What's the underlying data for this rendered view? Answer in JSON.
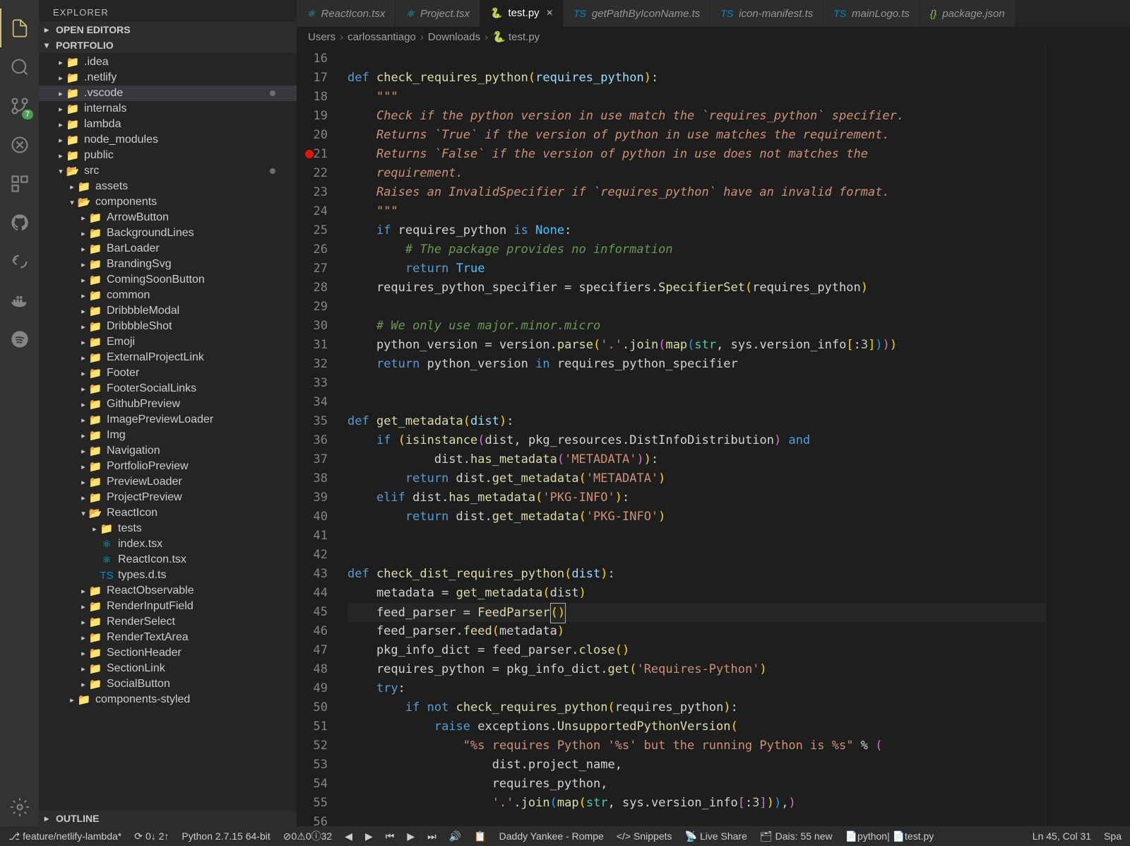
{
  "sidebar": {
    "title": "EXPLORER",
    "openEditors": "OPEN EDITORS",
    "projectName": "PORTFOLIO",
    "outline": "OUTLINE",
    "scm_badge": "7",
    "tree": [
      {
        "indent": 1,
        "chev": "▸",
        "iconClass": "folder-grey",
        "icon": "📁",
        "label": ".idea"
      },
      {
        "indent": 1,
        "chev": "▸",
        "iconClass": "folder-grey",
        "icon": "📁",
        "label": ".netlify"
      },
      {
        "indent": 1,
        "chev": "▸",
        "iconClass": "folder-blue",
        "icon": "📁",
        "label": ".vscode",
        "mod": true,
        "selected": true
      },
      {
        "indent": 1,
        "chev": "▸",
        "iconClass": "folder-grey",
        "icon": "📁",
        "label": "internals"
      },
      {
        "indent": 1,
        "chev": "▸",
        "iconClass": "folder-i",
        "icon": "📁",
        "label": "lambda"
      },
      {
        "indent": 1,
        "chev": "▸",
        "iconClass": "folder-green",
        "icon": "📁",
        "label": "node_modules"
      },
      {
        "indent": 1,
        "chev": "▸",
        "iconClass": "folder-blue",
        "icon": "📁",
        "label": "public"
      },
      {
        "indent": 1,
        "chev": "▾",
        "iconClass": "folder-green",
        "icon": "📂",
        "label": "src",
        "mod": true
      },
      {
        "indent": 2,
        "chev": "▸",
        "iconClass": "folder-yellow",
        "icon": "📁",
        "label": "assets"
      },
      {
        "indent": 2,
        "chev": "▾",
        "iconClass": "folder-teal",
        "icon": "📂",
        "label": "components"
      },
      {
        "indent": 3,
        "chev": "▸",
        "iconClass": "folder-grey",
        "icon": "📁",
        "label": "ArrowButton"
      },
      {
        "indent": 3,
        "chev": "▸",
        "iconClass": "folder-grey",
        "icon": "📁",
        "label": "BackgroundLines"
      },
      {
        "indent": 3,
        "chev": "▸",
        "iconClass": "folder-grey",
        "icon": "📁",
        "label": "BarLoader"
      },
      {
        "indent": 3,
        "chev": "▸",
        "iconClass": "folder-grey",
        "icon": "📁",
        "label": "BrandingSvg"
      },
      {
        "indent": 3,
        "chev": "▸",
        "iconClass": "folder-grey",
        "icon": "📁",
        "label": "ComingSoonButton"
      },
      {
        "indent": 3,
        "chev": "▸",
        "iconClass": "folder-grey",
        "icon": "📁",
        "label": "common"
      },
      {
        "indent": 3,
        "chev": "▸",
        "iconClass": "folder-grey",
        "icon": "📁",
        "label": "DribbbleModal"
      },
      {
        "indent": 3,
        "chev": "▸",
        "iconClass": "folder-grey",
        "icon": "📁",
        "label": "DribbbleShot"
      },
      {
        "indent": 3,
        "chev": "▸",
        "iconClass": "folder-grey",
        "icon": "📁",
        "label": "Emoji"
      },
      {
        "indent": 3,
        "chev": "▸",
        "iconClass": "folder-grey",
        "icon": "📁",
        "label": "ExternalProjectLink"
      },
      {
        "indent": 3,
        "chev": "▸",
        "iconClass": "folder-grey",
        "icon": "📁",
        "label": "Footer"
      },
      {
        "indent": 3,
        "chev": "▸",
        "iconClass": "folder-grey",
        "icon": "📁",
        "label": "FooterSocialLinks"
      },
      {
        "indent": 3,
        "chev": "▸",
        "iconClass": "folder-grey",
        "icon": "📁",
        "label": "GithubPreview"
      },
      {
        "indent": 3,
        "chev": "▸",
        "iconClass": "folder-grey",
        "icon": "📁",
        "label": "ImagePreviewLoader"
      },
      {
        "indent": 3,
        "chev": "▸",
        "iconClass": "folder-teal",
        "icon": "📁",
        "label": "Img"
      },
      {
        "indent": 3,
        "chev": "▸",
        "iconClass": "folder-grey",
        "icon": "📁",
        "label": "Navigation"
      },
      {
        "indent": 3,
        "chev": "▸",
        "iconClass": "folder-grey",
        "icon": "📁",
        "label": "PortfolioPreview"
      },
      {
        "indent": 3,
        "chev": "▸",
        "iconClass": "folder-grey",
        "icon": "📁",
        "label": "PreviewLoader"
      },
      {
        "indent": 3,
        "chev": "▸",
        "iconClass": "folder-grey",
        "icon": "📁",
        "label": "ProjectPreview"
      },
      {
        "indent": 3,
        "chev": "▾",
        "iconClass": "folder-grey",
        "icon": "📂",
        "label": "ReactIcon"
      },
      {
        "indent": 4,
        "chev": "▸",
        "iconClass": "folder-green",
        "icon": "📁",
        "label": "tests"
      },
      {
        "indent": 4,
        "chev": "",
        "iconClass": "file-react",
        "icon": "⚛",
        "label": "index.tsx"
      },
      {
        "indent": 4,
        "chev": "",
        "iconClass": "file-react",
        "icon": "⚛",
        "label": "ReactIcon.tsx"
      },
      {
        "indent": 4,
        "chev": "",
        "iconClass": "file-ts",
        "icon": "TS",
        "label": "types.d.ts"
      },
      {
        "indent": 3,
        "chev": "▸",
        "iconClass": "folder-grey",
        "icon": "📁",
        "label": "ReactObservable"
      },
      {
        "indent": 3,
        "chev": "▸",
        "iconClass": "folder-grey",
        "icon": "📁",
        "label": "RenderInputField"
      },
      {
        "indent": 3,
        "chev": "▸",
        "iconClass": "folder-grey",
        "icon": "📁",
        "label": "RenderSelect"
      },
      {
        "indent": 3,
        "chev": "▸",
        "iconClass": "folder-grey",
        "icon": "📁",
        "label": "RenderTextArea"
      },
      {
        "indent": 3,
        "chev": "▸",
        "iconClass": "folder-grey",
        "icon": "📁",
        "label": "SectionHeader"
      },
      {
        "indent": 3,
        "chev": "▸",
        "iconClass": "folder-grey",
        "icon": "📁",
        "label": "SectionLink"
      },
      {
        "indent": 3,
        "chev": "▸",
        "iconClass": "folder-grey",
        "icon": "📁",
        "label": "SocialButton"
      },
      {
        "indent": 2,
        "chev": "▸",
        "iconClass": "folder-grey",
        "icon": "📁",
        "label": "components-styled"
      }
    ]
  },
  "tabs": [
    {
      "iconClass": "file-react",
      "label": "ReactIcon.tsx",
      "active": false
    },
    {
      "iconClass": "file-react",
      "label": "Project.tsx",
      "active": false
    },
    {
      "iconClass": "file-py",
      "label": "test.py",
      "active": true
    },
    {
      "iconClass": "file-ts",
      "label": "getPathByIconName.ts",
      "active": false
    },
    {
      "iconClass": "file-ts",
      "label": "icon-manifest.ts",
      "active": false
    },
    {
      "iconClass": "file-ts",
      "label": "mainLogo.ts",
      "active": false
    },
    {
      "iconClass": "file-json",
      "label": "package.json",
      "active": false,
      "italic": true
    }
  ],
  "breadcrumb": [
    "Users",
    "carlossantiago",
    "Downloads",
    "test.py"
  ],
  "gutter": {
    "start": 16,
    "end": 56,
    "breakpoint": 21
  },
  "code_lines": [
    "",
    "<span class='kw'>def</span> <span class='fn'>check_requires_python</span><span class='pun'>(</span><span class='self'>requires_python</span><span class='pun'>)</span>:",
    "    <span class='doc'>\"\"\"</span>",
    "    <span class='doc'>Check if the python version in use match the `requires_python` specifier.</span>",
    "    <span class='doc'>Returns `True` if the version of python in use matches the requirement.</span>",
    "    <span class='doc'>Returns `False` if the version of python in use does not matches the</span>",
    "    <span class='doc'>requirement.</span>",
    "    <span class='doc'>Raises an InvalidSpecifier if `requires_python` have an invalid format.</span>",
    "    <span class='doc'>\"\"\"</span>",
    "    <span class='kw'>if</span> requires_python <span class='kw'>is</span> <span class='const'>None</span>:",
    "        <span class='cmt'># The package provides no information</span>",
    "        <span class='kw'>return</span> <span class='const'>True</span>",
    "    requires_python_specifier <span class='op'>=</span> specifiers.<span class='fn'>SpecifierSet</span><span class='pun'>(</span>requires_python<span class='pun'>)</span>",
    "",
    "    <span class='cmt'># We only use major.minor.micro</span>",
    "    python_version <span class='op'>=</span> version.<span class='fn'>parse</span><span class='pun'>(</span><span class='str'>'.'</span>.<span class='fn'>join</span><span class='pun2'>(</span><span class='fn'>map</span><span class='pun3'>(</span><span class='type'>str</span>, sys.version_info<span class='pun'>[</span>:<span class='num'>3</span><span class='pun'>]</span><span class='pun3'>)</span><span class='pun2'>)</span><span class='pun'>)</span>",
    "    <span class='kw'>return</span> python_version <span class='kw'>in</span> requires_python_specifier",
    "",
    "",
    "<span class='kw'>def</span> <span class='fn'>get_metadata</span><span class='pun'>(</span><span class='self'>dist</span><span class='pun'>)</span>:",
    "    <span class='kw'>if</span> <span class='pun'>(</span><span class='fn'>isinstance</span><span class='pun2'>(</span>dist, pkg_resources.DistInfoDistribution<span class='pun2'>)</span> <span class='kw'>and</span>",
    "            dist.<span class='fn'>has_metadata</span><span class='pun2'>(</span><span class='str'>'METADATA'</span><span class='pun2'>)</span><span class='pun'>)</span>:",
    "        <span class='kw'>return</span> dist.<span class='fn'>get_metadata</span><span class='pun'>(</span><span class='str'>'METADATA'</span><span class='pun'>)</span>",
    "    <span class='kw'>elif</span> dist.<span class='fn'>has_metadata</span><span class='pun'>(</span><span class='str'>'PKG-INFO'</span><span class='pun'>)</span>:",
    "        <span class='kw'>return</span> dist.<span class='fn'>get_metadata</span><span class='pun'>(</span><span class='str'>'PKG-INFO'</span><span class='pun'>)</span>",
    "",
    "",
    "<span class='kw'>def</span> <span class='fn'>check_dist_requires_python</span><span class='pun'>(</span><span class='self'>dist</span><span class='pun'>)</span>:",
    "    metadata <span class='op'>=</span> <span class='fn'>get_metadata</span><span class='pun'>(</span>dist<span class='pun'>)</span>",
    "    feed_parser <span class='op'>=</span> <span class='fn'>FeedParser</span><span class='cursor-mark'><span class='pun'>()</span></span>",
    "    feed_parser.<span class='fn'>feed</span><span class='pun'>(</span>metadata<span class='pun'>)</span>",
    "    pkg_info_dict <span class='op'>=</span> feed_parser.<span class='fn'>close</span><span class='pun'>()</span>",
    "    requires_python <span class='op'>=</span> pkg_info_dict.<span class='fn'>get</span><span class='pun'>(</span><span class='str'>'Requires-Python'</span><span class='pun'>)</span>",
    "    <span class='kw'>try</span>:",
    "        <span class='kw'>if</span> <span class='kw'>not</span> <span class='fn'>check_requires_python</span><span class='pun'>(</span>requires_python<span class='pun'>)</span>:",
    "            <span class='kw'>raise</span> exceptions.<span class='fn'>UnsupportedPythonVersion</span><span class='pun'>(</span>",
    "                <span class='str'>\"%s requires Python '%s' but the running Python is %s\"</span> <span class='op'>%</span> <span class='pun2'>(</span>",
    "                    dist.project_name,",
    "                    requires_python,",
    "                    <span class='str'>'.'</span>.<span class='fn'>join</span><span class='pun3'>(</span><span class='fn'>map</span><span class='pun'>(</span><span class='type'>str</span>, sys.version_info<span class='pun2'>[</span>:<span class='num'>3</span><span class='pun2'>]</span><span class='pun'>)</span><span class='pun3'>)</span>,<span class='pun2'>)</span>",
    ""
  ],
  "status": {
    "branch": "feature/netlify-lambda*",
    "sync": "0↓ 2↑",
    "python": "Python 2.7.15 64-bit",
    "errors": "0",
    "warnings": "0",
    "info": "32",
    "nowplaying": "Daddy Yankee - Rompe",
    "snippets": "Snippets",
    "liveshare": "Live Share",
    "dais": "Dais: 55 new",
    "lang": "python",
    "file": "test.py",
    "pos": "Ln 45, Col 31",
    "spaces": "Spa"
  }
}
